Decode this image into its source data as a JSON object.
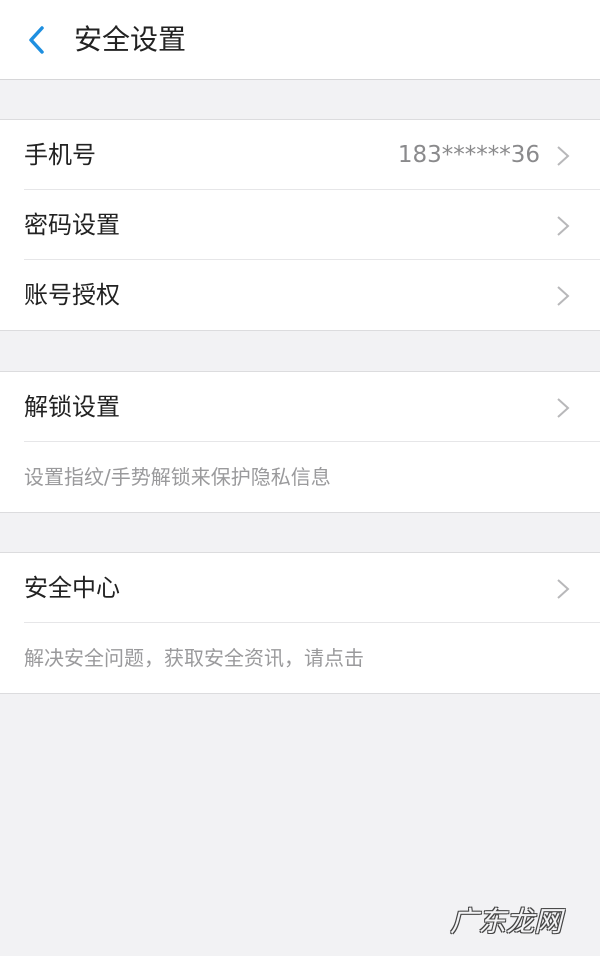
{
  "header": {
    "title": "安全设置",
    "back_icon": "chevron-left-icon",
    "back_color": "#1e8fe0"
  },
  "groups": [
    {
      "rows": [
        {
          "label": "手机号",
          "value": "183******36",
          "icon": "chevron-right-icon"
        },
        {
          "label": "密码设置",
          "icon": "chevron-right-icon"
        },
        {
          "label": "账号授权",
          "icon": "chevron-right-icon"
        }
      ]
    },
    {
      "rows": [
        {
          "label": "解锁设置",
          "icon": "chevron-right-icon"
        }
      ],
      "hint": "设置指纹/手势解锁来保护隐私信息"
    },
    {
      "rows": [
        {
          "label": "安全中心",
          "icon": "chevron-right-icon"
        }
      ],
      "hint": "解决安全问题，获取安全资讯，请点击"
    }
  ],
  "watermark": "广东龙网"
}
